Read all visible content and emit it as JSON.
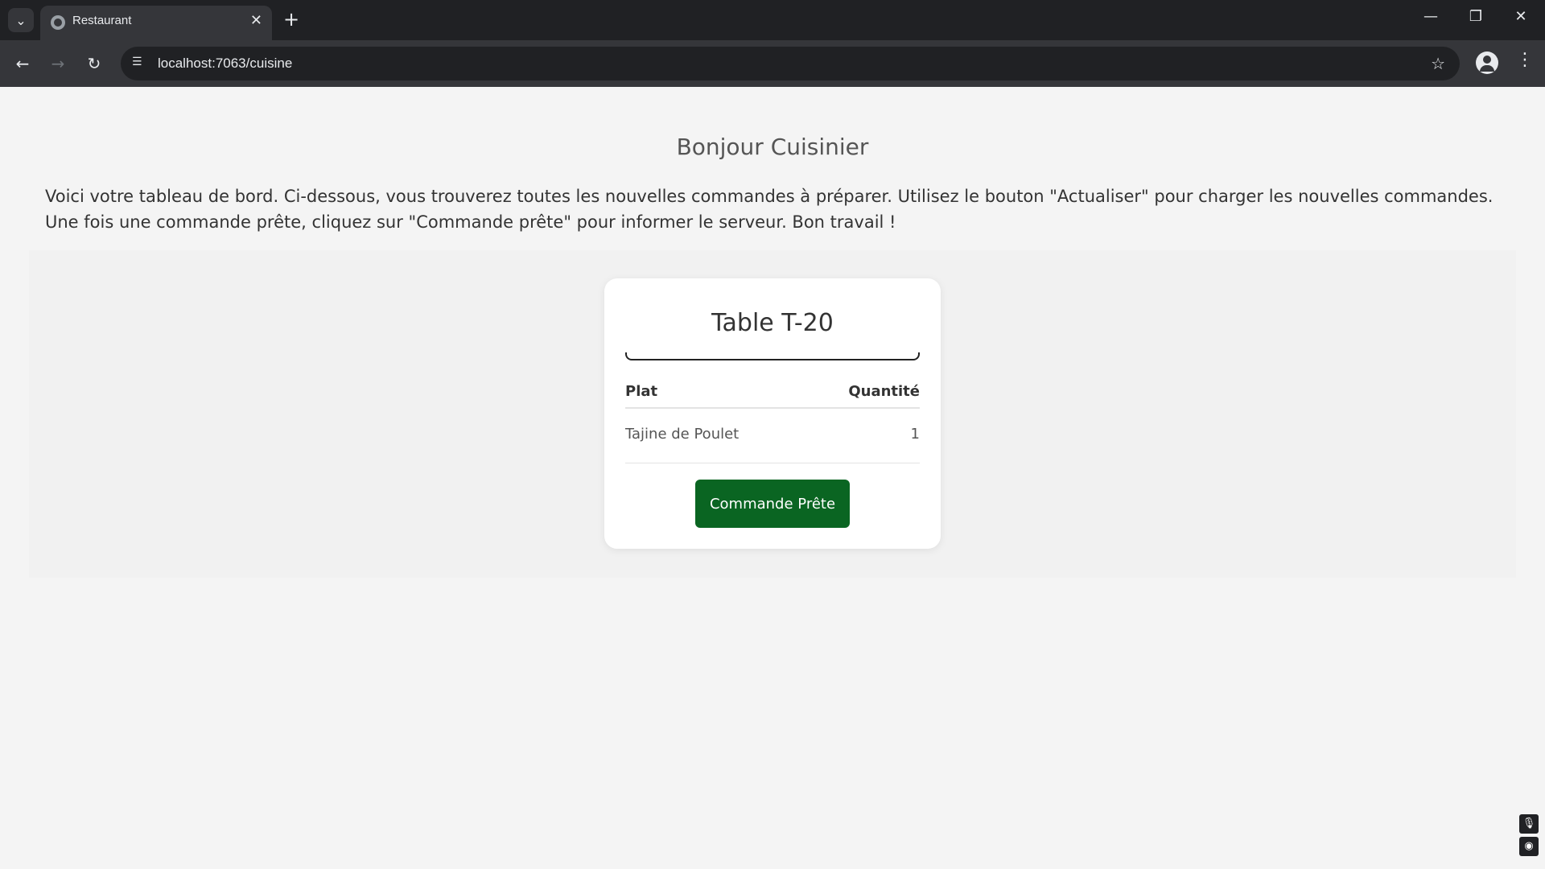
{
  "browser": {
    "tab_title": "Restaurant",
    "url": "localhost:7063/cuisine"
  },
  "page": {
    "greeting": "Bonjour Cuisinier",
    "intro": "Voici votre tableau de bord. Ci-dessous, vous trouverez toutes les nouvelles commandes à préparer. Utilisez le bouton \"Actualiser\" pour charger les nouvelles commandes. Une fois une commande prête, cliquez sur \"Commande prête\" pour informer le serveur. Bon travail !"
  },
  "order": {
    "table_label": "Table T-20",
    "columns": {
      "dish": "Plat",
      "quantity": "Quantité"
    },
    "items": [
      {
        "dish": "Tajine de Poulet",
        "quantity": "1"
      }
    ],
    "ready_button": "Commande Prête"
  },
  "colors": {
    "ready_button": "#0a6522",
    "page_bg": "#f4f4f4"
  }
}
